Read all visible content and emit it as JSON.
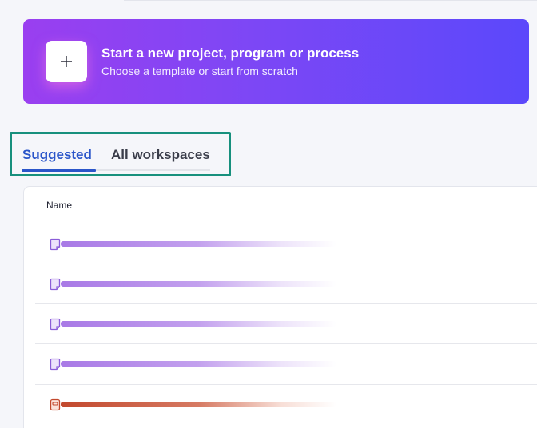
{
  "banner": {
    "title": "Start a new project, program or process",
    "subtitle": "Choose a template or start from scratch",
    "icon": "plus-icon"
  },
  "tabs": [
    {
      "label": "Suggested",
      "active": true
    },
    {
      "label": "All workspaces",
      "active": false
    }
  ],
  "table": {
    "columns": [
      "Name"
    ],
    "rows": [
      {
        "icon": "project-icon",
        "color": "#8a5cd8"
      },
      {
        "icon": "project-icon",
        "color": "#8a5cd8"
      },
      {
        "icon": "project-icon",
        "color": "#8a5cd8"
      },
      {
        "icon": "project-icon",
        "color": "#8a5cd8"
      },
      {
        "icon": "portfolio-icon",
        "color": "#c2482d"
      }
    ]
  },
  "colors": {
    "accent": "#2a55c9",
    "highlight": "#17907d",
    "banner_start": "#9a3ff0",
    "banner_end": "#5b48fb"
  }
}
